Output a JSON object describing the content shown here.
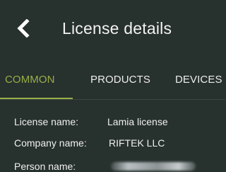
{
  "header": {
    "title": "License details"
  },
  "tabs": [
    {
      "label": "COMMON",
      "active": true
    },
    {
      "label": "PRODUCTS",
      "active": false
    },
    {
      "label": "DEVICES",
      "active": false
    }
  ],
  "details": {
    "license_name_label": "License name:",
    "license_name_value": "Lamia license",
    "company_name_label": "Company name:",
    "company_name_value": "RIFTEK LLC",
    "person_name_label": "Person name:"
  },
  "colors": {
    "background": "#27312e",
    "accent": "#9aae46",
    "text": "#f0f0f0"
  },
  "icons": {
    "back": "chevron-left-icon"
  }
}
